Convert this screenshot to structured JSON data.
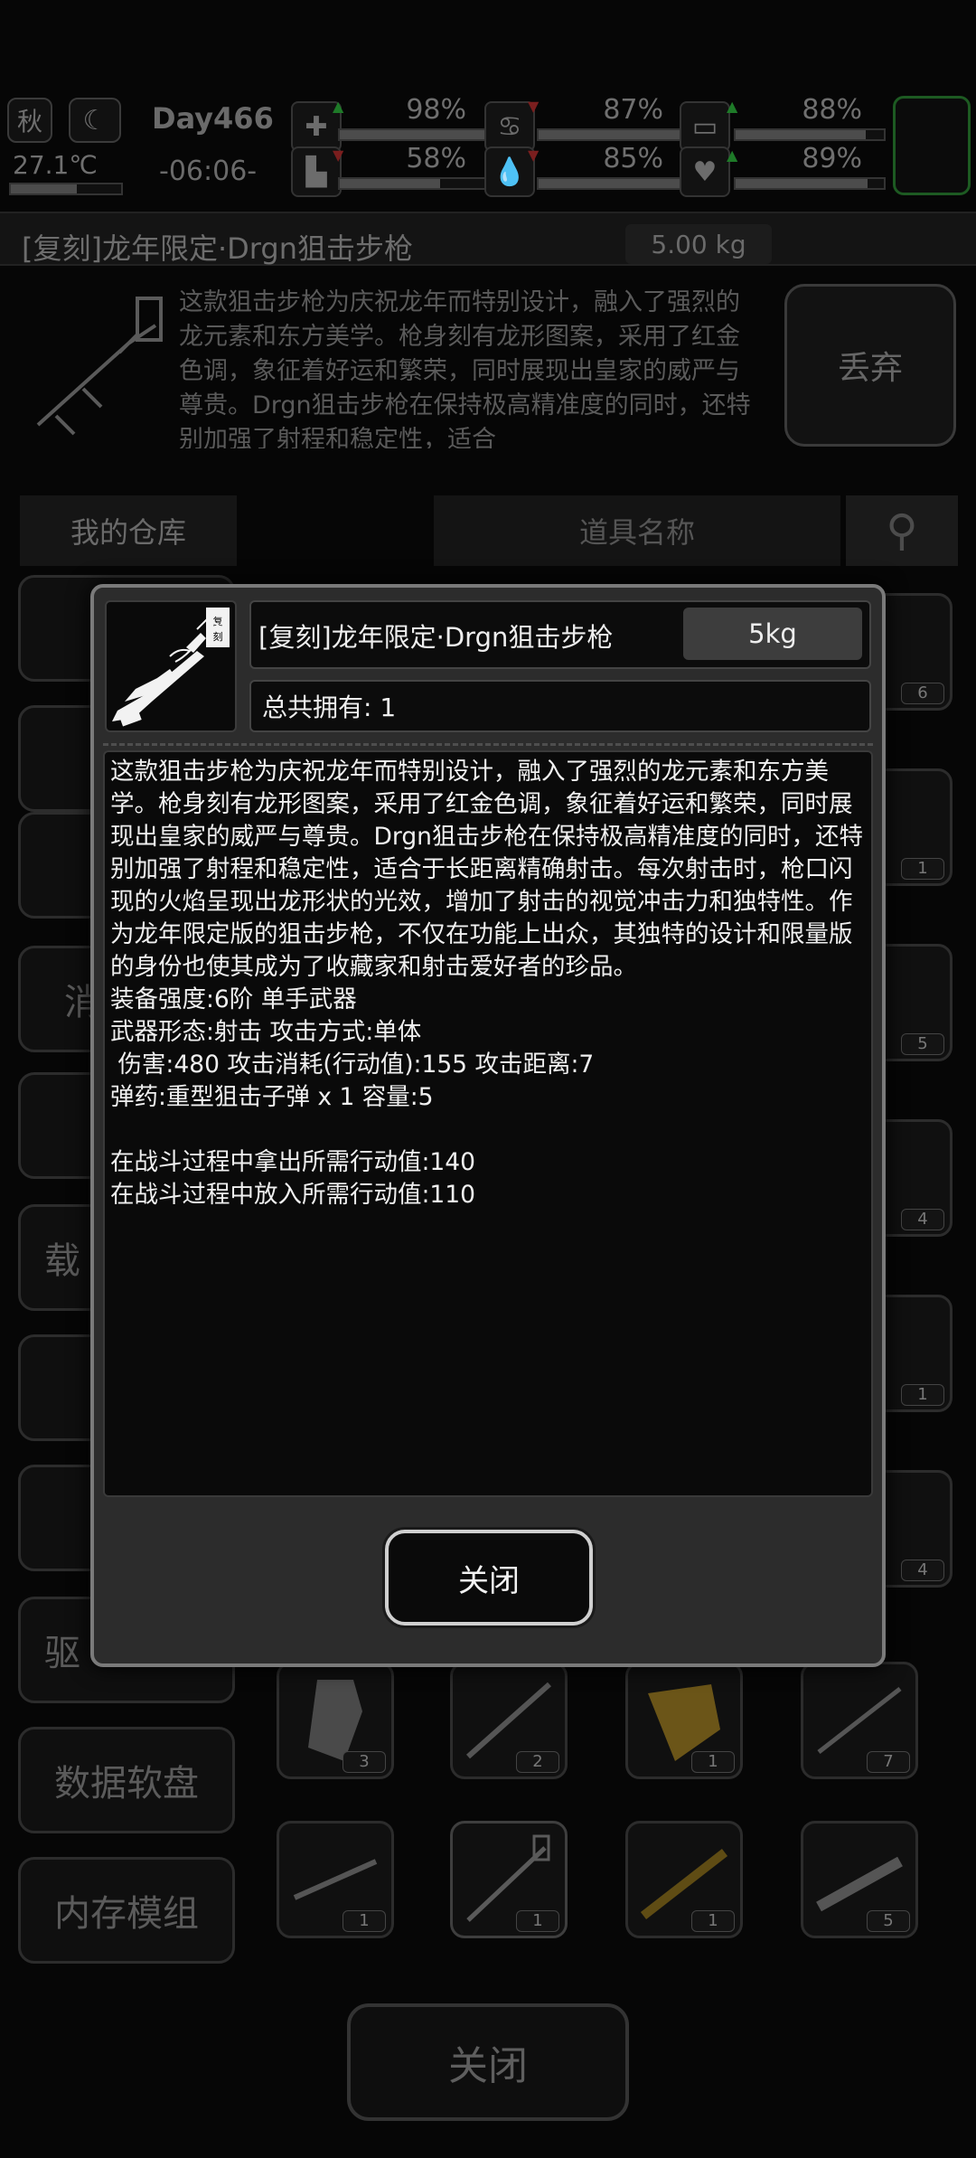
{
  "status": {
    "season": "秋",
    "temperature": "27.1℃",
    "day": "Day466",
    "time": "-06:06-",
    "stats": [
      {
        "name": "health",
        "icon": "medkit-icon",
        "value": "98%",
        "fill": 0.98,
        "trend": "up"
      },
      {
        "name": "food",
        "icon": "stomach-icon",
        "value": "87%",
        "fill": 0.87,
        "trend": "down"
      },
      {
        "name": "energy",
        "icon": "battery-icon",
        "value": "88%",
        "fill": 0.88,
        "trend": "up"
      },
      {
        "name": "stamina",
        "icon": "boot-icon",
        "value": "58%",
        "fill": 0.58,
        "trend": "down"
      },
      {
        "name": "water",
        "icon": "water-drop-icon",
        "value": "85%",
        "fill": 0.85,
        "trend": "down"
      },
      {
        "name": "mood",
        "icon": "heart-icon",
        "value": "89%",
        "fill": 0.89,
        "trend": "up"
      }
    ]
  },
  "background": {
    "item_name": "[复刻]龙年限定·Drgn狙击步枪",
    "item_weight": "5.00 kg",
    "item_description": "这款狙击步枪为庆祝龙年而特别设计，融入了强烈的龙元素和东方美学。枪身刻有龙形图案，采用了红金色调，象征着好运和繁荣，同时展现出皇家的威严与尊贵。Drgn狙击步枪在保持极高精准度的同时，还特别加强了射程和稳定性，适合",
    "discard_label": "丢弃",
    "store_tab": "我的仓库",
    "search_placeholder": "道具名称",
    "categories": [
      "消",
      "载",
      "驱",
      "数据软盘",
      "内存模组"
    ],
    "slot_counts": [
      "6",
      "1",
      "5",
      "4",
      "1",
      "4",
      "3",
      "2",
      "1",
      "7",
      "1",
      "1",
      "1",
      "5"
    ],
    "close_label": "关闭"
  },
  "dialog": {
    "title": "[复刻]龙年限定·Drgn狙击步枪",
    "weight": "5kg",
    "total_owned": "总共拥有:  1",
    "description_lines": [
      "这款狙击步枪为庆祝龙年而特别设计，融入了强烈的龙元素和东方美学。枪身刻有龙形图案，采用了红金色调，象征着好运和繁荣，同时展现出皇家的威严与尊贵。Drgn狙击步枪在保持极高精准度的同时，还特别加强了射程和稳定性，适合于长距离精确射击。每次射击时，枪口闪现的火焰呈现出龙形状的光效，增加了射击的视觉冲击力和独特性。作为龙年限定版的狙击步枪，不仅在功能上出众，其独特的设计和限量版的身份也使其成为了收藏家和射击爱好者的珍品。",
      "装备强度:6阶 单手武器",
      "武器形态:射击 攻击方式:单体",
      " 伤害:480 攻击消耗(行动值):155 攻击距离:7",
      "弹药:重型狙击子弹 x 1 容量:5",
      "",
      "在战斗过程中拿出所需行动值:140",
      "在战斗过程中放入所需行动值:110"
    ],
    "close_label": "关闭",
    "badge_text": "复刻"
  }
}
